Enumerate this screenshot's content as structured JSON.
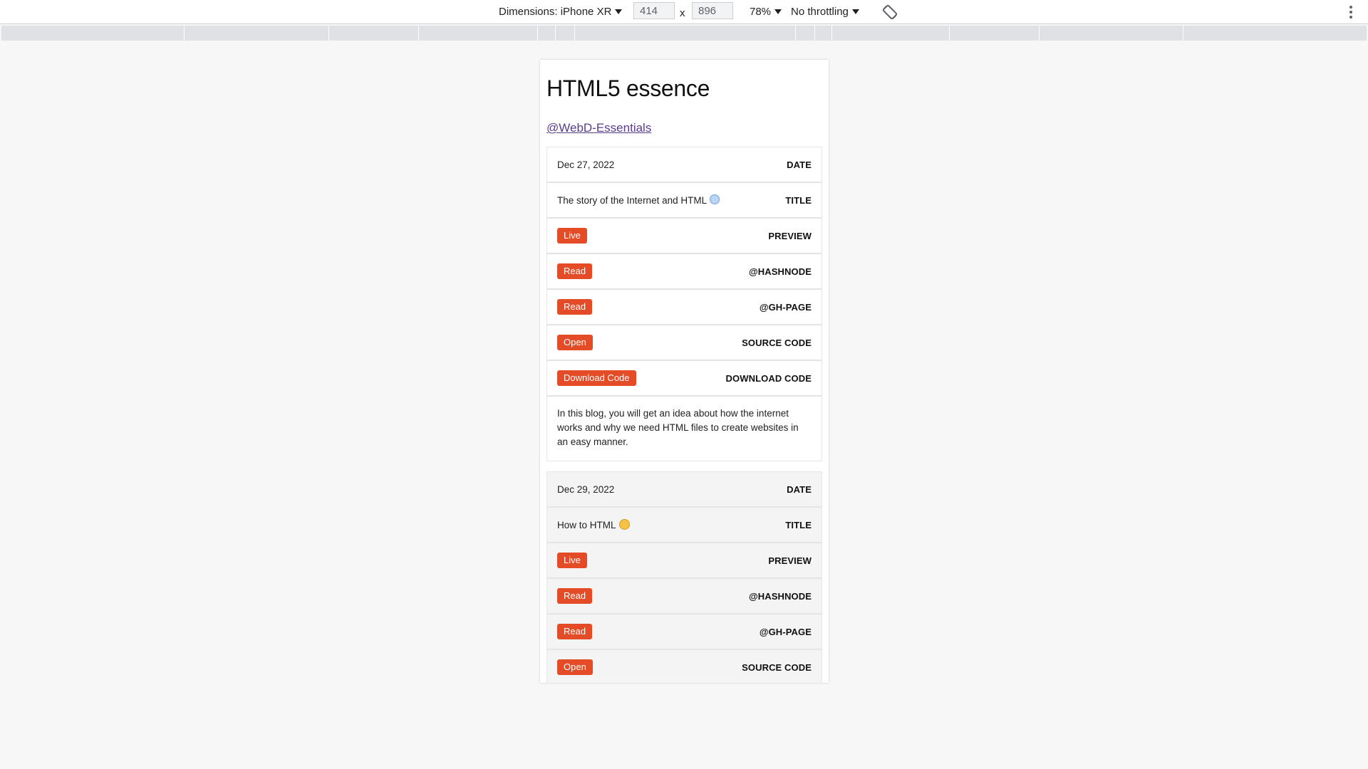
{
  "devtools": {
    "dimensions_label": "Dimensions: iPhone XR",
    "width_value": "414",
    "times": "x",
    "height_value": "896",
    "zoom": "78%",
    "throttling": "No throttling"
  },
  "page": {
    "title": "HTML5 essence",
    "handle": "@WebD-Essentials"
  },
  "labels": {
    "date": "DATE",
    "title": "TITLE",
    "preview": "PREVIEW",
    "hashnode": "@HASHNODE",
    "ghpage": "@GH-PAGE",
    "source": "SOURCE CODE",
    "download": "DOWNLOAD CODE"
  },
  "buttons": {
    "live": "Live",
    "read": "Read",
    "open": "Open",
    "download": "Download Code"
  },
  "posts": [
    {
      "date": "Dec 27, 2022",
      "title": "The story of the Internet and HTML",
      "emoji": "globe-icon",
      "description": "In this blog, you will get an idea about how the internet works and why we need HTML files to create websites in an easy manner."
    },
    {
      "date": "Dec 29, 2022",
      "title": "How to HTML",
      "emoji": "thinking-face-icon"
    }
  ],
  "colors": {
    "accent": "#e34c26",
    "link": "#5a3c8c"
  }
}
